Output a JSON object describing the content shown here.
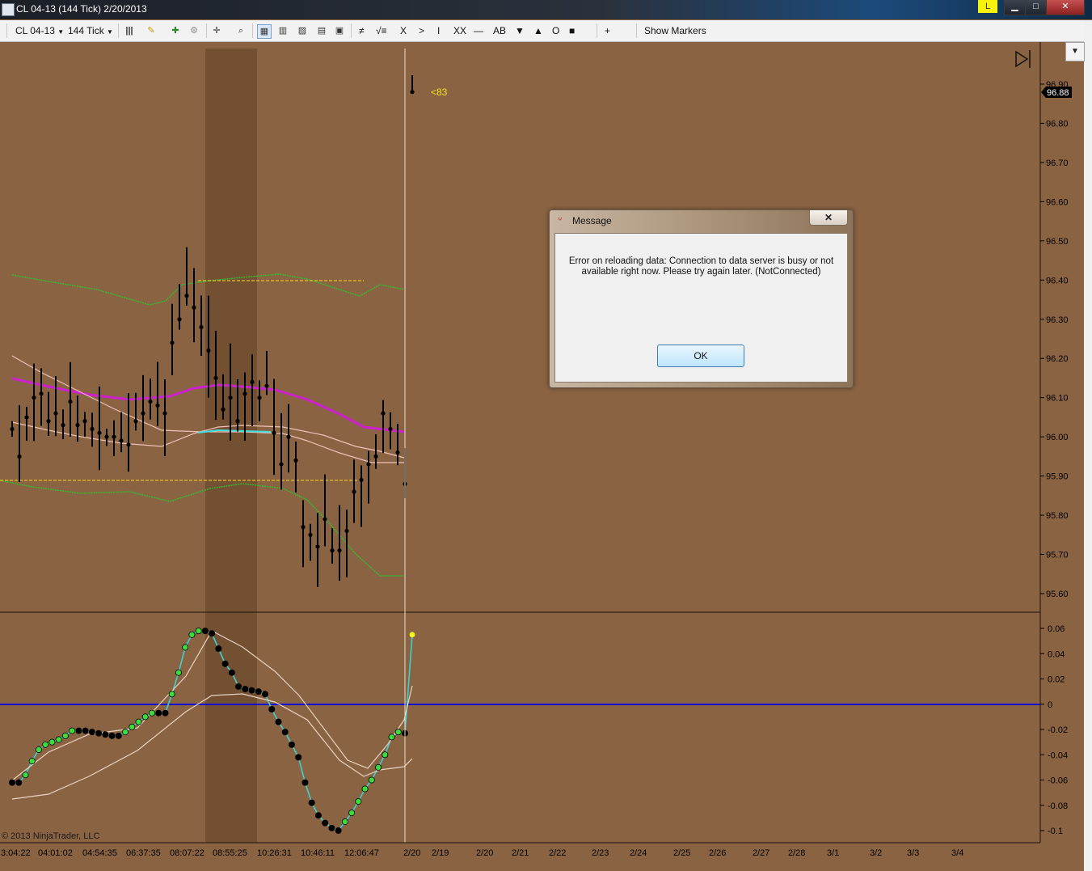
{
  "window": {
    "title": "CL 04-13 (144 Tick)  2/20/2013",
    "badge": "L",
    "minimize": "▁",
    "maximize": "□",
    "close": "✕"
  },
  "toolbar": {
    "instrument": "CL 04-13",
    "interval": "144 Tick",
    "tools": [
      "≠",
      "√≡",
      "X",
      ">",
      "I",
      "XX",
      "—",
      "AB",
      "▼",
      "▲",
      "O",
      "■"
    ],
    "plus": "+",
    "show_markers": "Show Markers"
  },
  "chart": {
    "last_price_label": "96.88",
    "annotation": "<83",
    "copyright": "© 2013 NinjaTrader, LLC"
  },
  "chart_data": [
    {
      "type": "bar",
      "panel": "price",
      "ylim": [
        95.55,
        96.95
      ],
      "yticks": [
        "96.90",
        "96.80",
        "96.70",
        "96.60",
        "96.50",
        "96.40",
        "96.30",
        "96.20",
        "96.10",
        "96.00",
        "95.90",
        "95.80",
        "95.70",
        "95.60"
      ],
      "last_price": 96.88,
      "bars_close": [
        96.02,
        95.95,
        96.05,
        96.1,
        96.11,
        96.04,
        96.06,
        96.03,
        96.09,
        96.03,
        96.04,
        96.02,
        96.01,
        96.0,
        96.0,
        95.99,
        95.98,
        96.04,
        96.06,
        96.09,
        96.08,
        96.06,
        96.24,
        96.3,
        96.36,
        96.33,
        96.28,
        96.22,
        96.15,
        96.07,
        96.1,
        96.04,
        96.11,
        96.14,
        96.1,
        96.13,
        96.01,
        95.93,
        96.0,
        95.94,
        95.77,
        95.75,
        95.72,
        95.79,
        95.71,
        95.71,
        95.76,
        95.86,
        95.89,
        95.93,
        95.95,
        96.06,
        96.02,
        95.96,
        95.88
      ],
      "series": [
        {
          "name": "",
          "color": "#cc22cc"
        },
        {
          "name": "",
          "color": "#f0c0b8"
        },
        {
          "name": "",
          "color": "#2fbf2f"
        },
        {
          "name": "",
          "color": "#e8c020"
        }
      ]
    },
    {
      "type": "line",
      "panel": "oscillator",
      "ylim": [
        -0.11,
        0.07
      ],
      "yticks": [
        "0.06",
        "0.04",
        "0.02",
        "0",
        "-0.02",
        "-0.04",
        "-0.06",
        "-0.08",
        "-0.1"
      ],
      "values": [
        -0.062,
        -0.062,
        -0.056,
        -0.045,
        -0.036,
        -0.032,
        -0.03,
        -0.028,
        -0.025,
        -0.021,
        -0.021,
        -0.021,
        -0.022,
        -0.023,
        -0.024,
        -0.025,
        -0.025,
        -0.022,
        -0.018,
        -0.014,
        -0.01,
        -0.007,
        -0.007,
        -0.007,
        0.008,
        0.025,
        0.045,
        0.055,
        0.058,
        0.058,
        0.056,
        0.044,
        0.032,
        0.025,
        0.014,
        0.012,
        0.011,
        0.01,
        0.008,
        -0.004,
        -0.014,
        -0.022,
        -0.032,
        -0.042,
        -0.062,
        -0.078,
        -0.088,
        -0.094,
        -0.098,
        -0.1,
        -0.093,
        -0.086,
        -0.077,
        -0.067,
        -0.06,
        -0.05,
        -0.04,
        -0.026,
        -0.022,
        -0.023
      ],
      "last_value": 0.055,
      "zero_line": 0,
      "xticks": [
        "3:04:22",
        "04:01:02",
        "04:54:35",
        "06:37:35",
        "08:07:22",
        "08:55:25",
        "10:26:31",
        "10:46:11",
        "12:06:47",
        "2/20",
        "2/19",
        "2/20",
        "2/21",
        "2/22",
        "2/23",
        "2/24",
        "2/25",
        "2/26",
        "2/27",
        "2/28",
        "3/1",
        "3/2",
        "3/3",
        "3/4"
      ]
    }
  ],
  "dialog": {
    "title": "Message",
    "close": "✕",
    "text": "Error on reloading data: Connection to data server is busy or not available right now. Please try again later. (NotConnected)",
    "ok": "OK"
  }
}
